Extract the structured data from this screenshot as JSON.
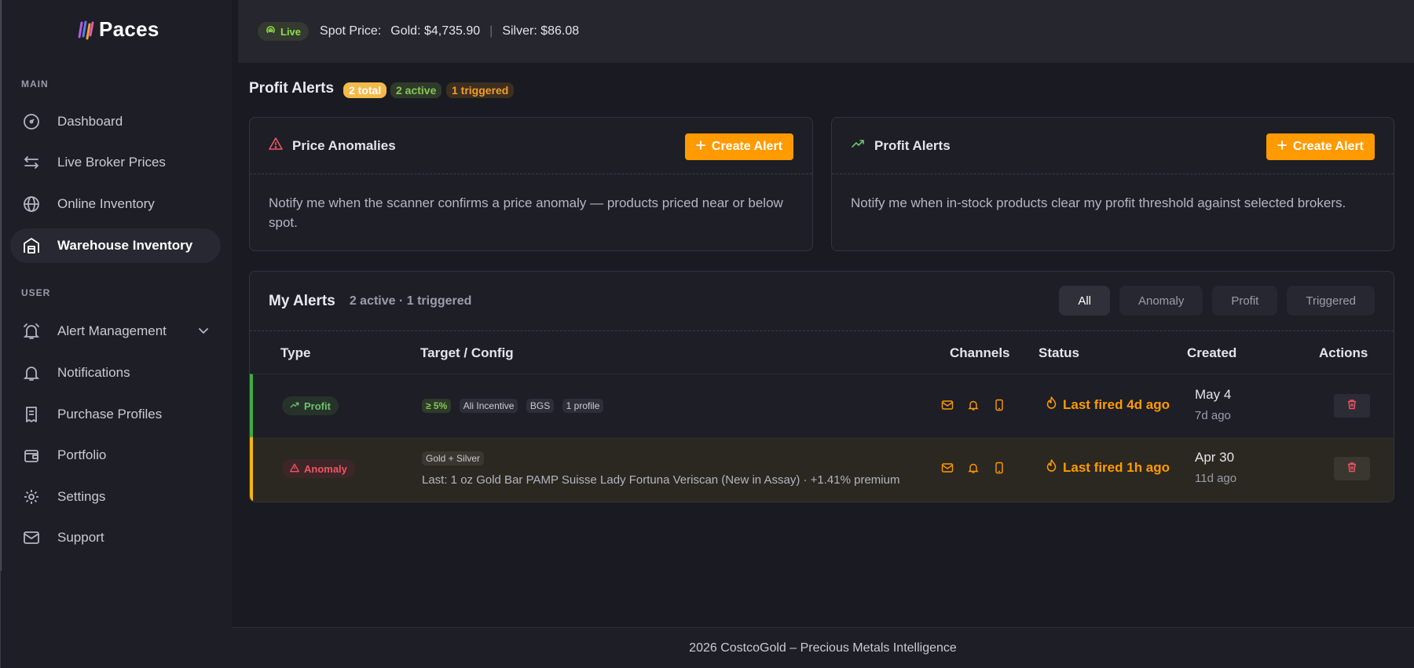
{
  "brand": {
    "name": "Paces"
  },
  "topbar": {
    "live_label": "Live",
    "spot_label": "Spot Price:",
    "gold": "Gold: $4,735.90",
    "divider": "|",
    "silver": "Silver: $86.08"
  },
  "sidebar": {
    "main_label": "MAIN",
    "user_label": "USER",
    "main_items": [
      {
        "label": "Dashboard",
        "icon": "gauge-icon"
      },
      {
        "label": "Live Broker Prices",
        "icon": "arrows-icon"
      },
      {
        "label": "Online Inventory",
        "icon": "globe-icon"
      },
      {
        "label": "Warehouse Inventory",
        "icon": "warehouse-icon",
        "active": true
      }
    ],
    "user_items": [
      {
        "label": "Alert Management",
        "icon": "alarm-icon",
        "expandable": true
      },
      {
        "label": "Notifications",
        "icon": "bell-icon"
      },
      {
        "label": "Purchase Profiles",
        "icon": "receipt-icon"
      },
      {
        "label": "Portfolio",
        "icon": "wallet-icon"
      },
      {
        "label": "Settings",
        "icon": "gear-icon"
      },
      {
        "label": "Support",
        "icon": "mail-icon"
      }
    ]
  },
  "page": {
    "title": "Profit Alerts",
    "badges": {
      "total": "2 total",
      "active": "2 active",
      "triggered": "1 triggered"
    }
  },
  "cards": [
    {
      "title": "Price Anomalies",
      "button": "Create Alert",
      "body": "Notify me when the scanner confirms a price anomaly — products priced near or below spot."
    },
    {
      "title": "Profit Alerts",
      "button": "Create Alert",
      "body": "Notify me when in-stock products clear my profit threshold against selected brokers."
    }
  ],
  "my_alerts": {
    "title": "My Alerts",
    "summary": "2 active · 1 triggered",
    "filters": [
      "All",
      "Anomaly",
      "Profit",
      "Triggered"
    ],
    "columns": [
      "Type",
      "Target / Config",
      "Channels",
      "Status",
      "Created",
      "Actions"
    ],
    "rows": [
      {
        "type": "Profit",
        "chips": [
          "≥ 5%",
          "Ali Incentive",
          "BGS",
          "1 profile"
        ],
        "status": "Last fired 4d ago",
        "created": "May 4",
        "ago": "7d ago"
      },
      {
        "type": "Anomaly",
        "chips": [
          "Gold + Silver"
        ],
        "detail": "Last: 1 oz Gold Bar PAMP Suisse Lady Fortuna Veriscan (New in Assay) · +1.41% premium",
        "status": "Last fired 1h ago",
        "created": "Apr 30",
        "ago": "11d ago"
      }
    ]
  },
  "footer": {
    "text": "2026 CostcoGold – Precious Metals Intelligence"
  },
  "colors": {
    "accent": "#ff9a00",
    "profit": "#3faa45",
    "anomaly": "#f5b60a",
    "danger": "#ef5563"
  }
}
